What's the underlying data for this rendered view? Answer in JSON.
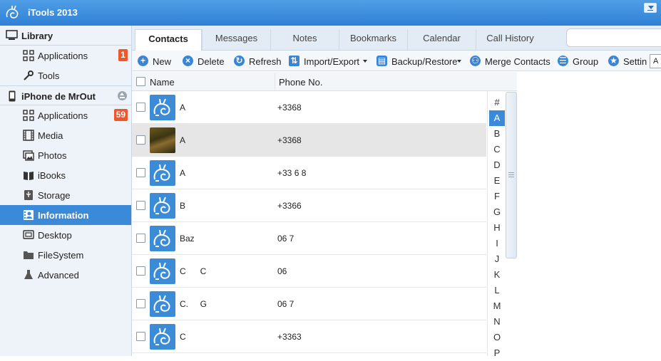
{
  "app": {
    "title": "iTools 2013"
  },
  "sidebar": {
    "library": {
      "label": "Library",
      "items": [
        {
          "label": "Applications",
          "badge": "1",
          "icon": "grid-icon"
        },
        {
          "label": "Tools",
          "badge": "",
          "icon": "wrench-icon"
        }
      ]
    },
    "device": {
      "label": "iPhone de MrOut",
      "items": [
        {
          "label": "Applications",
          "badge": "59",
          "icon": "grid-icon"
        },
        {
          "label": "Media",
          "badge": "",
          "icon": "film-icon"
        },
        {
          "label": "Photos",
          "badge": "",
          "icon": "photo-icon"
        },
        {
          "label": "iBooks",
          "badge": "",
          "icon": "book-icon"
        },
        {
          "label": "Storage",
          "badge": "",
          "icon": "usb-icon"
        },
        {
          "label": "Information",
          "badge": "",
          "icon": "contact-card-icon",
          "active": true
        },
        {
          "label": "Desktop",
          "badge": "",
          "icon": "desktop-icon"
        },
        {
          "label": "FileSystem",
          "badge": "",
          "icon": "folder-icon"
        },
        {
          "label": "Advanced",
          "badge": "",
          "icon": "flask-icon"
        }
      ]
    }
  },
  "tabs": [
    "Contacts",
    "Messages",
    "Notes",
    "Bookmarks",
    "Calendar",
    "Call History"
  ],
  "toolbar": {
    "new": "New",
    "delete": "Delete",
    "refresh": "Refresh",
    "import_export": "Import/Export",
    "backup_restore": "Backup/Restore",
    "merge": "Merge Contacts",
    "group": "Group",
    "settings": "Settin",
    "edge": "A"
  },
  "table": {
    "columns": {
      "name": "Name",
      "phone": "Phone No."
    },
    "rows": [
      {
        "name": "A",
        "phone": "+3368",
        "photo": false,
        "selected": false
      },
      {
        "name": "A",
        "phone": "+3368",
        "photo": true,
        "selected": true
      },
      {
        "name": "A",
        "phone": "+33 6 8",
        "photo": false,
        "selected": false
      },
      {
        "name": "B",
        "phone": "+3366",
        "photo": false,
        "selected": false
      },
      {
        "name": "Baz",
        "phone": "06 7",
        "photo": false,
        "selected": false
      },
      {
        "name": "C      C",
        "phone": "06",
        "photo": false,
        "selected": false
      },
      {
        "name": "C.     G",
        "phone": "06 7",
        "photo": false,
        "selected": false
      },
      {
        "name": "C",
        "phone": "+3363",
        "photo": false,
        "selected": false
      }
    ]
  },
  "alpha_index": [
    "#",
    "A",
    "B",
    "C",
    "D",
    "E",
    "F",
    "G",
    "H",
    "I",
    "J",
    "K",
    "L",
    "M",
    "N",
    "O",
    "P"
  ],
  "alpha_active": "A",
  "colors": {
    "titlebar": "#3a8ad9",
    "accent": "#3a8ad9",
    "badge": "#f0562c"
  }
}
